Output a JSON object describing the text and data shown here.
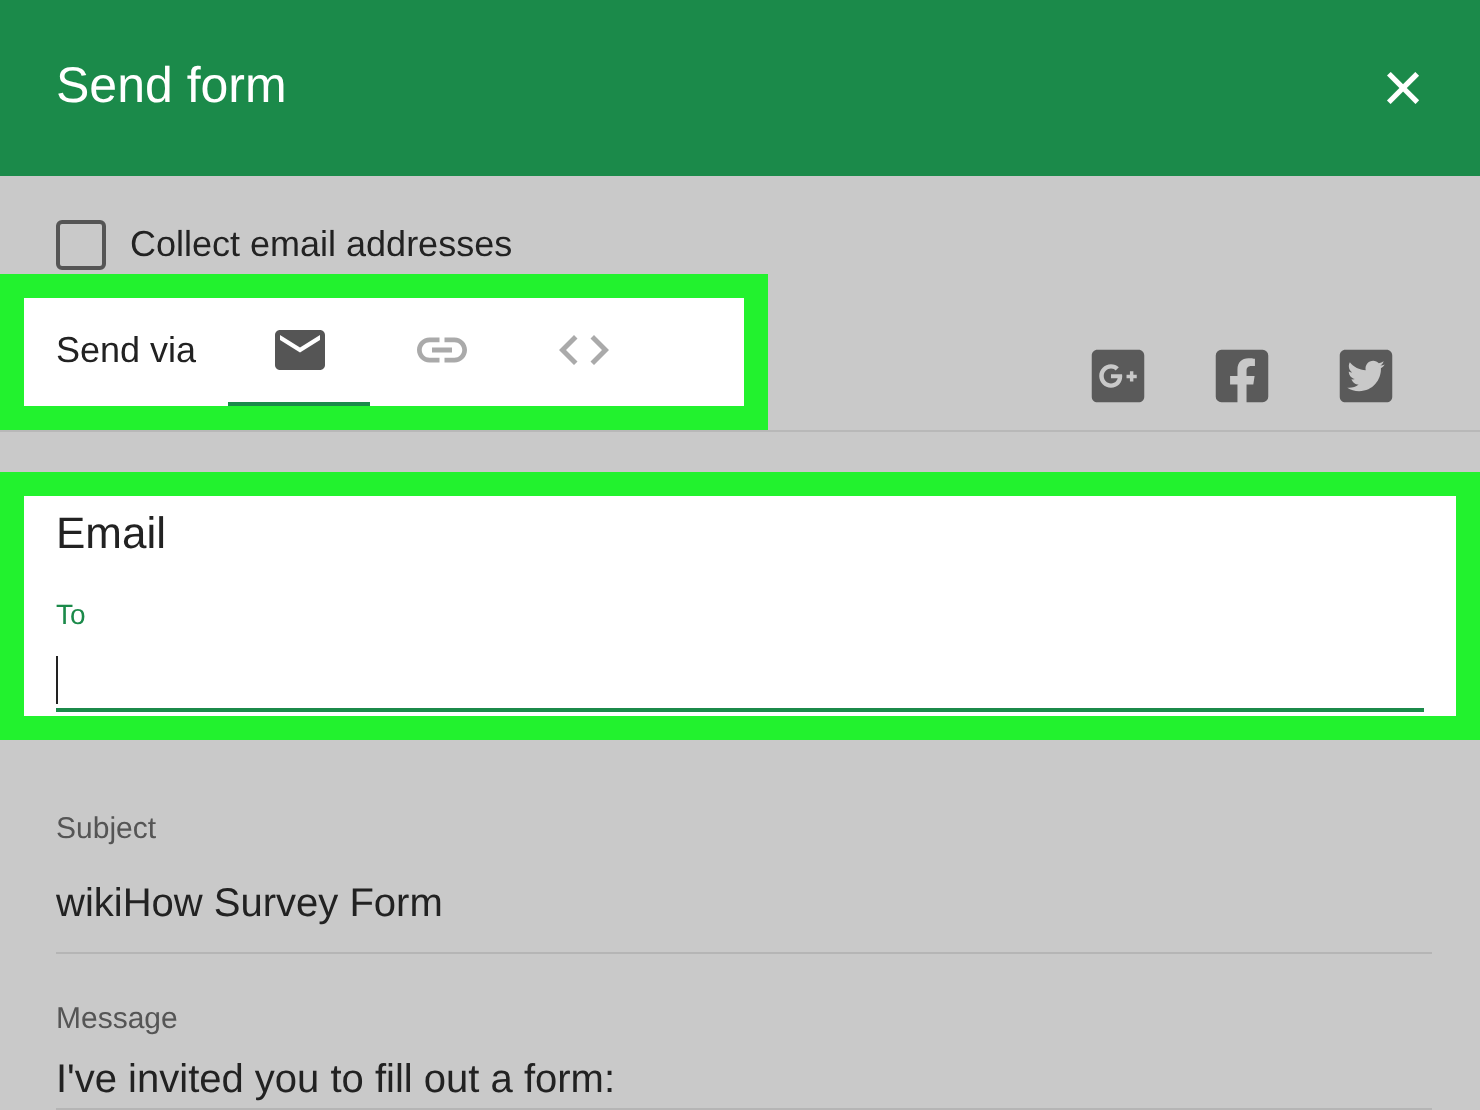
{
  "dialog": {
    "title": "Send form",
    "close": "×"
  },
  "collect_emails": {
    "label": "Collect email addresses",
    "checked": false
  },
  "send_via": {
    "label": "Send via",
    "highlighted": true,
    "tabs": [
      {
        "kind": "email",
        "selected": true
      },
      {
        "kind": "link",
        "selected": false
      },
      {
        "kind": "embed",
        "selected": false
      }
    ]
  },
  "share": [
    {
      "kind": "googleplus"
    },
    {
      "kind": "facebook"
    },
    {
      "kind": "twitter"
    }
  ],
  "email": {
    "heading": "Email",
    "highlighted": true,
    "to": {
      "label": "To",
      "focused": true
    }
  },
  "subject": {
    "label": "Subject",
    "value": "wikiHow Survey Form"
  },
  "message": {
    "label": "Message",
    "value": "I've invited you to fill out a form:"
  }
}
